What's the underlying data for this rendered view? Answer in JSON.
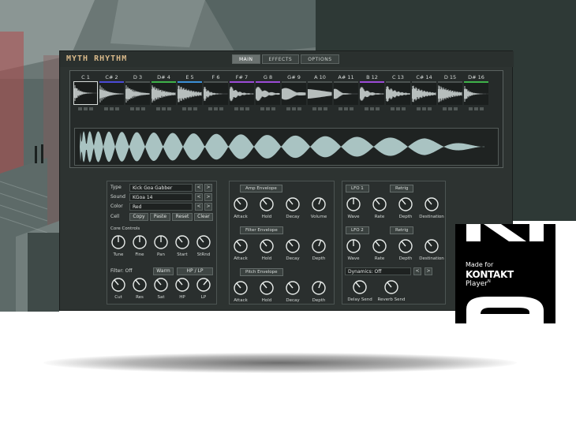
{
  "app": {
    "title": "MYTH RHYTHM"
  },
  "tabs": [
    {
      "label": "MAIN",
      "active": true
    },
    {
      "label": "EFFECTS",
      "active": false
    },
    {
      "label": "OPTIONS",
      "active": false
    }
  ],
  "pads": [
    {
      "note": "C 1",
      "color": "#e8e8e8"
    },
    {
      "note": "C# 2",
      "color": "#4b4bd6"
    },
    {
      "note": "D 3",
      "color": "#4b5250"
    },
    {
      "note": "D# 4",
      "color": "#3fb24a"
    },
    {
      "note": "E 5",
      "color": "#3b8fd6"
    },
    {
      "note": "F 6",
      "color": "#4b5250"
    },
    {
      "note": "F# 7",
      "color": "#9b4bd6"
    },
    {
      "note": "G 8",
      "color": "#9b4bd6"
    },
    {
      "note": "G# 9",
      "color": "#4b5250"
    },
    {
      "note": "A 10",
      "color": "#4b5250"
    },
    {
      "note": "A# 11",
      "color": "#4b5250"
    },
    {
      "note": "B 12",
      "color": "#9b4bd6"
    },
    {
      "note": "C 13",
      "color": "#4b5250"
    },
    {
      "note": "C# 14",
      "color": "#4b5250"
    },
    {
      "note": "D 15",
      "color": "#4b5250"
    },
    {
      "note": "D# 16",
      "color": "#3fb24a"
    }
  ],
  "sound": {
    "type_label": "Type",
    "type_value": "Kick Goa Gabber",
    "sound_label": "Sound",
    "sound_value": "KGoa 14",
    "color_label": "Color",
    "color_value": "Red",
    "cell_label": "Cell",
    "cell_buttons": [
      "Copy",
      "Paste",
      "Reset",
      "Clear"
    ],
    "arrow_left": "<",
    "arrow_right": ">"
  },
  "core": {
    "title": "Core Controls",
    "knobs": [
      "Tune",
      "Fine",
      "Pan",
      "Start",
      "StRnd"
    ]
  },
  "filter": {
    "label": "Filter: Off",
    "warm": "Warm",
    "mode": "HP / LP",
    "knobs": [
      "Cut",
      "Res",
      "Sat",
      "HP",
      "LP"
    ]
  },
  "envelopes": [
    {
      "title": "Amp Envelope",
      "knobs": [
        "Attack",
        "Hold",
        "Decay",
        "Volume"
      ]
    },
    {
      "title": "Filter Envelope",
      "knobs": [
        "Attack",
        "Hold",
        "Decay",
        "Depth"
      ]
    },
    {
      "title": "Pitch Envelope",
      "knobs": [
        "Attack",
        "Hold",
        "Decay",
        "Depth"
      ]
    }
  ],
  "lfos": [
    {
      "title": "LFO 1",
      "retrig": "Retrig",
      "knobs": [
        "Wave",
        "Rate",
        "Depth",
        "Destination"
      ]
    },
    {
      "title": "LFO 2",
      "retrig": "Retrig",
      "knobs": [
        "Wave",
        "Rate",
        "Depth",
        "Destination"
      ]
    }
  ],
  "dynamics": {
    "label": "Dynamics: Off",
    "knobs": [
      "Delay Send",
      "Reverb Send"
    ]
  },
  "badge": {
    "made_for": "Made for",
    "brand": "KONTAKT",
    "player": "Player",
    "player_suffix": "N"
  },
  "colors": {
    "panel": "#2d3331",
    "knob_ring": "#e8ecea",
    "wave": "#a9c3c2",
    "accent_text": "#d9b98a"
  }
}
